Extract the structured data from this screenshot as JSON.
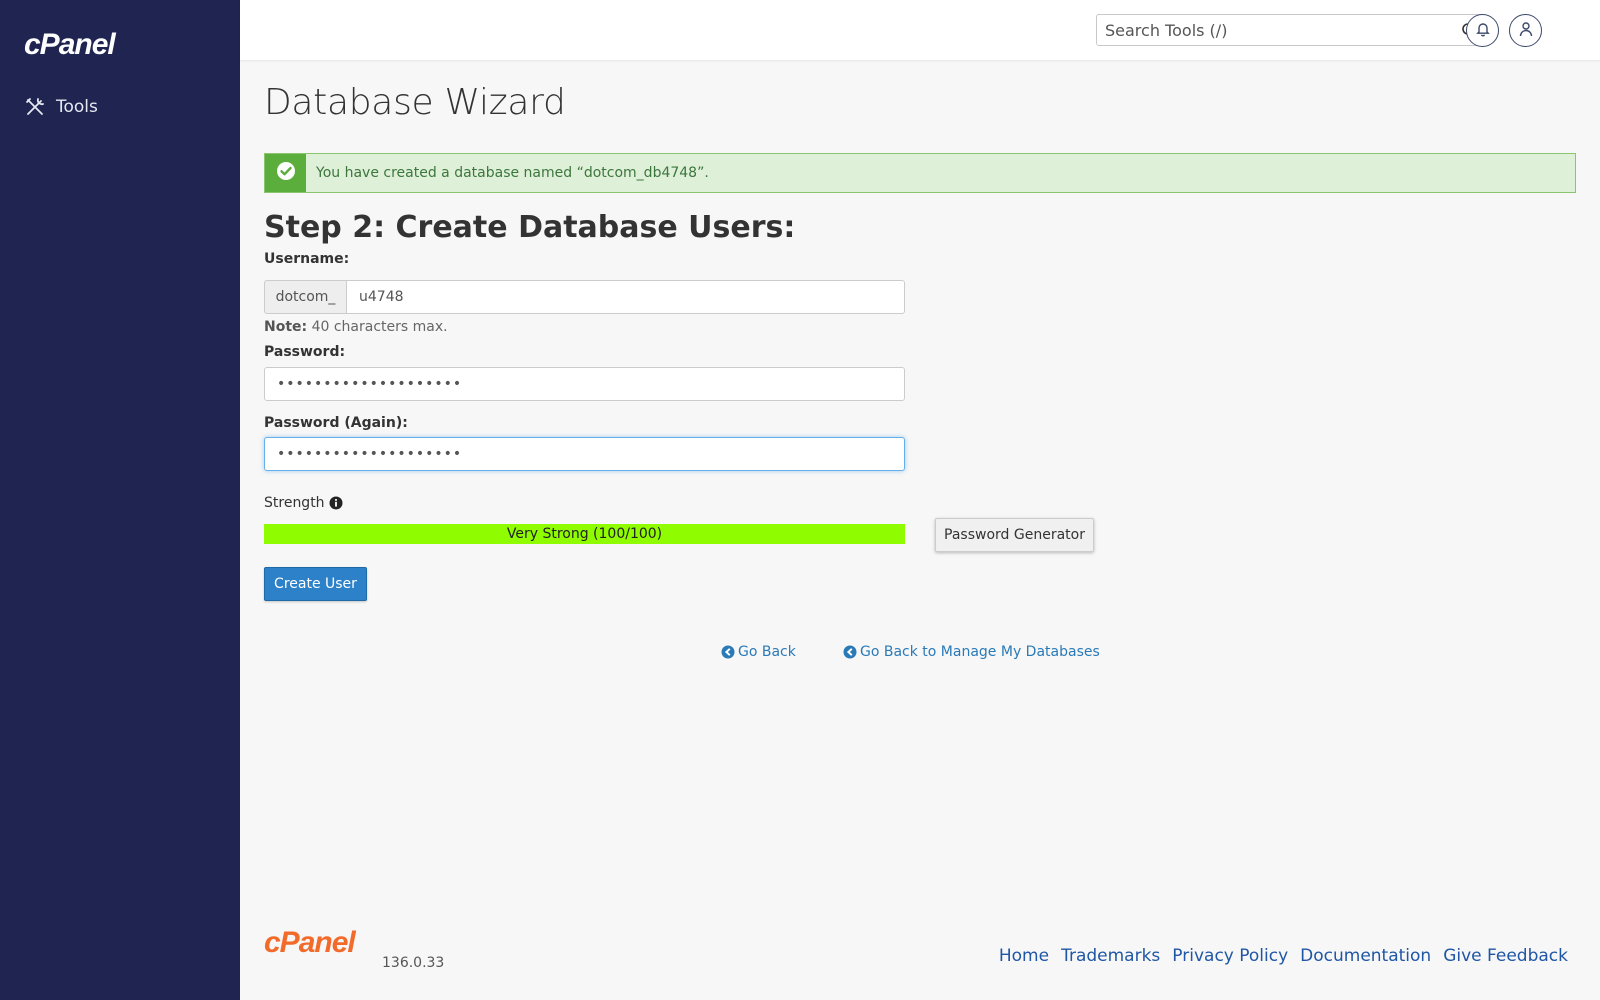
{
  "sidebar": {
    "logo": "cPanel",
    "items": [
      {
        "label": "Tools",
        "icon": "tools-icon"
      }
    ]
  },
  "header": {
    "search_placeholder": "Search Tools (/)",
    "icons": [
      "search-icon",
      "bell-icon",
      "user-icon"
    ]
  },
  "main": {
    "page_title": "Database Wizard",
    "alert": {
      "text": "You have created a database named “dotcom_db4748”.",
      "icon": "check-circle-icon"
    },
    "step_title": "Step 2: Create Database Users:",
    "username": {
      "label": "Username:",
      "prefix": "dotcom_",
      "value": "u4748"
    },
    "note": {
      "bold": "Note:",
      "text": " 40 characters max."
    },
    "password": {
      "label": "Password:",
      "value": "••••••••••••••••••••"
    },
    "password_again": {
      "label": "Password (Again):",
      "value": "••••••••••••••••••••"
    },
    "strength": {
      "label": "Strength",
      "bar_text": "Very Strong (100/100)",
      "score": 100,
      "max": 100,
      "color": "#8ffc00"
    },
    "password_generator_label": "Password Generator",
    "create_user_label": "Create User",
    "go_back_label": "Go Back",
    "go_back_manage_label": "Go Back to Manage My Databases"
  },
  "footer": {
    "logo": "cPanel",
    "version": "136.0.33",
    "links": [
      "Home",
      "Trademarks",
      "Privacy Policy",
      "Documentation",
      "Give Feedback"
    ]
  },
  "colors": {
    "sidebar_bg": "#1f2451",
    "brand_orange": "#f26b2b",
    "primary_button": "#2c81c8",
    "success_bg": "#dff0d8",
    "link": "#2a7ab8"
  }
}
